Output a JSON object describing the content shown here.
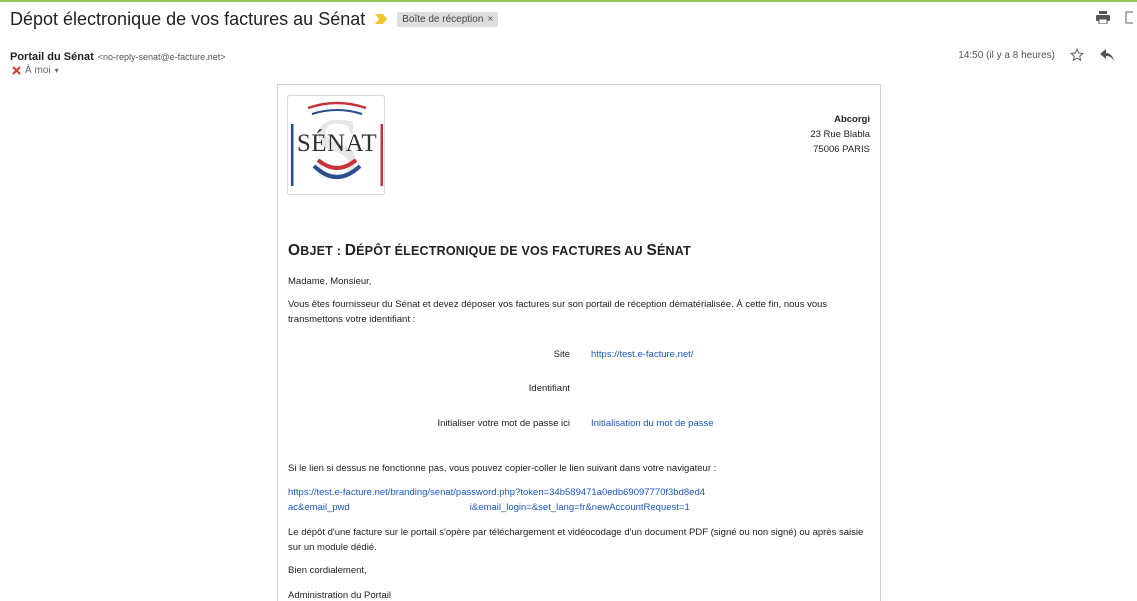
{
  "email": {
    "subject": "Dépot électronique de vos factures au Sénat",
    "label_chip": "Boîte de réception",
    "label_close": "×",
    "sender_name": "Portail du Sénat",
    "sender_email": "<no-reply-senat@e-facture.net>",
    "to_label": "À moi",
    "to_caret": "▾",
    "timestamp": "14:50 (il y a 8 heures)"
  },
  "letter": {
    "logo_text": "SÉNAT",
    "address": {
      "company": "Abcorgi",
      "street": "23 Rue Blabla",
      "city": "75006 PARIS"
    },
    "heading": {
      "o": "O",
      "bjet": "BJET : ",
      "d": "D",
      "epot": "ÉPÔT ÉLECTRONIQUE DE VOS FACTURES AU ",
      "s": "S",
      "enat": "ÉNAT"
    },
    "greeting": "Madame, Monsieur,",
    "intro": "Vous êtes fournisseur du Sénat et devez déposer vos factures sur son portail de réception dématérialisée. À cette fin, nous vous transmettons votre identifiant :",
    "site_label": "Site",
    "site_value": "https://test.e-facture.net/",
    "id_label": "Identifiant",
    "reset_label": "Initialiser votre mot de passe ici",
    "reset_value": "Initialisation du mot de passe",
    "fallback": "Si le lien si dessus ne fonctionne pas, vous pouvez copier-coller le lien suivant dans votre navigateur :",
    "long_link_1": "https://test.e-facture.net/branding/senat/password.php?token=34b589471a0edb69097770f3bd8ed4",
    "long_link_2a": "ac&email_pwd",
    "long_link_2b": "i&email_login=&set_lang=fr&newAccountRequest=1",
    "depot": "Le dépôt d'une facture sur le portail s'opère par téléchargement et vidéocodage d'un document PDF (signé ou non signé) ou après saisie sur un module dédié.",
    "closing": "Bien cordialement,",
    "signoff": "Administration du Portail"
  },
  "icons": {
    "importance": "importance-marker-icon",
    "print": "print-icon",
    "open_new": "open-in-new-window-icon",
    "star": "star-icon",
    "reply": "reply-icon",
    "to_flag": "flag-icon"
  },
  "colors": {
    "link": "#1a57c2",
    "importance": "#f2c42e",
    "top_line": "#9bc45a",
    "senat_red": "#c8333b",
    "senat_blue": "#2a4f8f"
  }
}
